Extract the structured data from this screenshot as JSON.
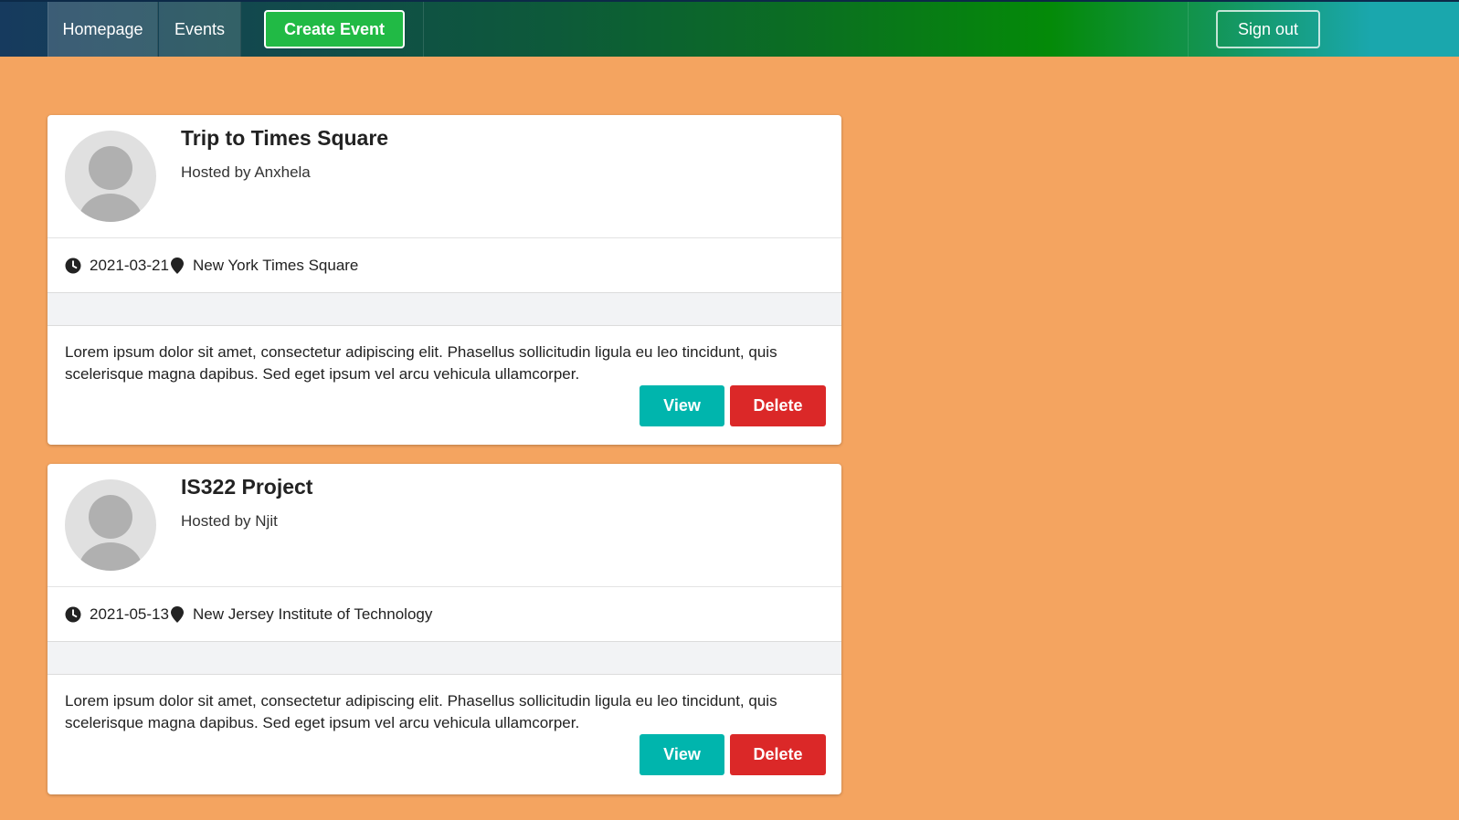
{
  "nav": {
    "homepage": "Homepage",
    "events": "Events",
    "create_event": "Create Event",
    "sign_out": "Sign out"
  },
  "events": [
    {
      "title": "Trip to Times Square",
      "host": "Hosted by Anxhela",
      "date": "2021-03-21",
      "location": "New York Times Square",
      "description": "Lorem ipsum dolor sit amet, consectetur adipiscing elit. Phasellus sollicitudin ligula eu leo tincidunt, quis scelerisque magna dapibus. Sed eget ipsum vel arcu vehicula ullamcorper.",
      "view_label": "View",
      "delete_label": "Delete"
    },
    {
      "title": "IS322 Project",
      "host": "Hosted by Njit",
      "date": "2021-05-13",
      "location": "New Jersey Institute of Technology",
      "description": "Lorem ipsum dolor sit amet, consectetur adipiscing elit. Phasellus sollicitudin ligula eu leo tincidunt, quis scelerisque magna dapibus. Sed eget ipsum vel arcu vehicula ullamcorper.",
      "view_label": "View",
      "delete_label": "Delete"
    }
  ],
  "colors": {
    "page_background": "#f4a460",
    "create_button": "#21ba45",
    "view_button": "#00b5ad",
    "delete_button": "#db2828"
  },
  "icons": {
    "date": "clock-icon",
    "location": "map-marker-icon",
    "avatar": "user-avatar-placeholder"
  }
}
